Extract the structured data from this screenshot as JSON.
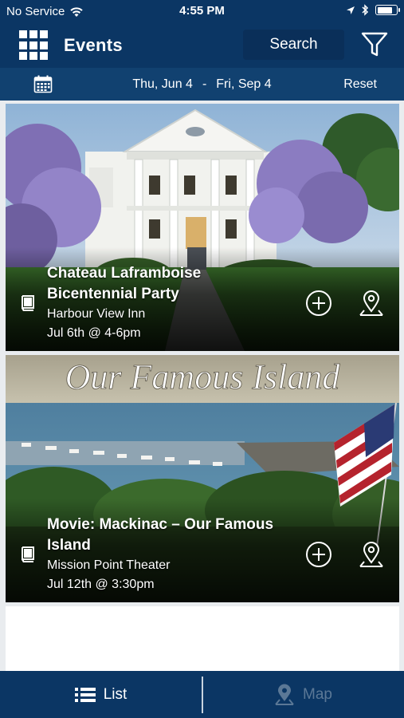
{
  "status_bar": {
    "carrier": "No Service",
    "time": "4:55 PM",
    "battery_level": 0.85
  },
  "header": {
    "title": "Events",
    "search_label": "Search",
    "menu_icon": "grid-menu-icon",
    "filter_icon": "filter-icon"
  },
  "datebar": {
    "start": "Thu, Jun 4",
    "separator": "-",
    "end": "Fri, Sep 4",
    "reset_label": "Reset",
    "calendar_icon": "calendar-icon"
  },
  "events": [
    {
      "name_line1": "Chateau Laframboise",
      "name_line2": "Bicentennial Party",
      "venue": "Harbour View Inn",
      "when": "Jul 6th @ 4-6pm"
    },
    {
      "name_line1": "Movie: Mackinac – Our Famous",
      "name_line2": "Island",
      "venue": "Mission Point Theater",
      "when": "Jul 12th @ 3:30pm",
      "banner_text": "Our Famous Island"
    }
  ],
  "tabbar": {
    "list_label": "List",
    "map_label": "Map"
  },
  "colors": {
    "navy": "#0b3664",
    "datebar": "#114170",
    "inactive_tab": "#5b7896"
  }
}
